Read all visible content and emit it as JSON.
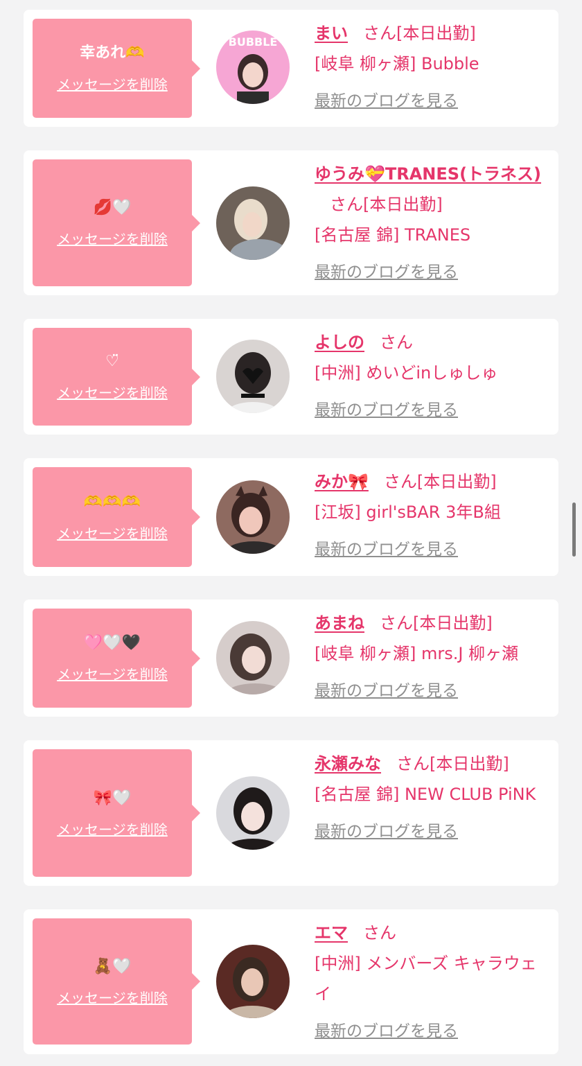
{
  "delete_label": "メッセージを削除",
  "blog_label": "最新のブログを見る",
  "san_label": "さん",
  "colors": {
    "accent": "#e5356a",
    "bubble": "#fb97a8",
    "link_gray": "#8f8f8f"
  },
  "items": [
    {
      "message": "幸あれ🫶",
      "name": "まい",
      "status": "[本日出勤]",
      "shop": "[岐阜 柳ヶ瀬] Bubble",
      "avatar_bg": "#f6a6d4",
      "avatar_text": "BUBBLE"
    },
    {
      "message": "💋🤍",
      "name": "ゆうみ💝TRANES(トラネス)",
      "status": "[本日出勤]",
      "shop": "[名古屋 錦] TRANES",
      "avatar_bg": "#a89a8e",
      "avatar_text": ""
    },
    {
      "message": "♡̈",
      "name": "よしの",
      "status": "",
      "shop": "[中洲] めいどinしゅしゅ",
      "avatar_bg": "#d9d4d2",
      "avatar_text": ""
    },
    {
      "message": "🫶🫶🫶",
      "name": "みか🎀",
      "status": "[本日出勤]",
      "shop": "[江坂] girl'sBAR 3年B組",
      "avatar_bg": "#c7a39a",
      "avatar_text": ""
    },
    {
      "message": "🩷🤍🖤",
      "name": "あまね",
      "status": "[本日出勤]",
      "shop": "[岐阜 柳ヶ瀬] mrs.J 柳ヶ瀬",
      "avatar_bg": "#d6cdcb",
      "avatar_text": ""
    },
    {
      "message": "🎀🤍",
      "name": "永瀬みな",
      "status": "[本日出勤]",
      "shop": "[名古屋 錦] NEW CLUB PiNK",
      "avatar_bg": "#d9d9dd",
      "avatar_text": ""
    },
    {
      "message": "🧸🤍",
      "name": "エマ",
      "status": "",
      "shop": "[中洲] メンバーズ キャラウェイ",
      "avatar_bg": "#5a2a24",
      "avatar_text": ""
    }
  ]
}
